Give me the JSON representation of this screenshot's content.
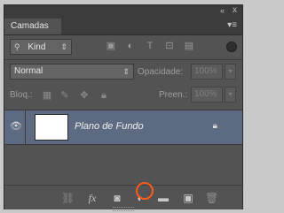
{
  "window": {
    "collapse_glyph": "«",
    "close_glyph": "x"
  },
  "tabs": [
    {
      "label": "Camadas"
    }
  ],
  "panel_menu_glyph": "▾≡",
  "filter": {
    "kind_label": "Kind",
    "icons": [
      "pixel-filter-icon",
      "adjustment-filter-icon",
      "type-filter-icon",
      "shape-filter-icon",
      "smart-object-filter-icon"
    ]
  },
  "blend": {
    "mode": "Normal",
    "opacity_label": "Opacidade:",
    "opacity_value": "100%"
  },
  "locks": {
    "label": "Bloq.:",
    "fill_label": "Preen.:",
    "fill_value": "100%"
  },
  "layers": [
    {
      "name": "Plano de Fundo",
      "visible": true,
      "locked": true
    }
  ],
  "bottom_bar": {
    "icons": [
      "link-icon",
      "fx-icon",
      "mask-icon",
      "adjustment-layer-icon",
      "group-folder-icon",
      "new-layer-icon",
      "trash-icon"
    ]
  },
  "highlight_color": "#ff5a1a"
}
